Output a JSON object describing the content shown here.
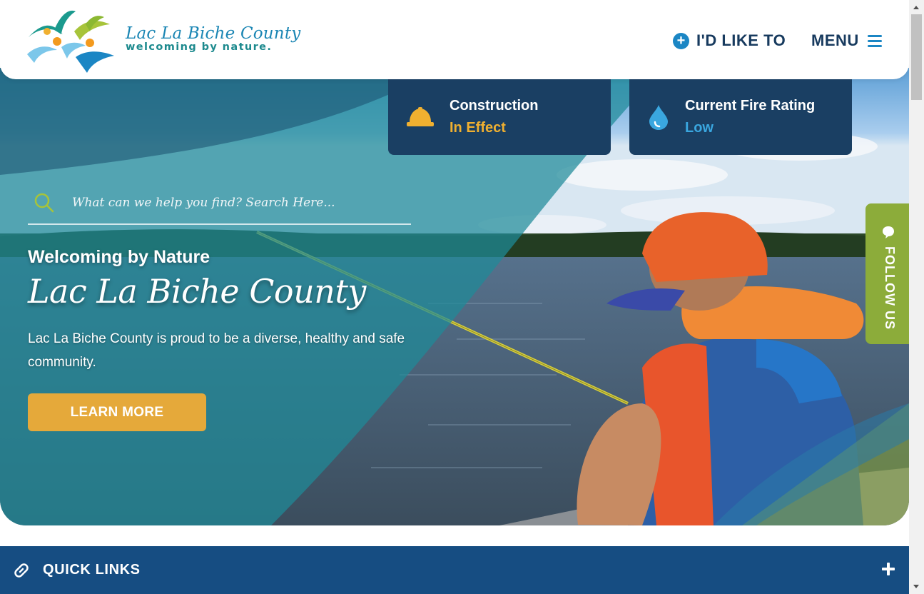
{
  "header": {
    "logo": {
      "title": "Lac La Biche County",
      "tagline": "welcoming by nature."
    },
    "nav": {
      "like_to_label": "I'D LIKE TO",
      "menu_label": "MENU"
    }
  },
  "status_cards": [
    {
      "title": "Construction",
      "value": "In Effect",
      "icon": "hard-hat-icon",
      "value_color": "#f0b030"
    },
    {
      "title": "Current Fire Rating",
      "value": "Low",
      "icon": "water-drop-icon",
      "value_color": "#3aa7e0"
    }
  ],
  "search": {
    "placeholder": "What can we help you find? Search Here..."
  },
  "hero": {
    "subtitle": "Welcoming by Nature",
    "title": "Lac La Biche County",
    "text": "Lac La Biche County is proud to be a diverse, healthy and safe community.",
    "button_label": "LEARN MORE"
  },
  "follow": {
    "label": "FOLLOW US"
  },
  "quick_links": {
    "label": "QUICK LINKS"
  },
  "colors": {
    "navy": "#173a5e",
    "accent_blue": "#1b86c4",
    "gold": "#e5a93a",
    "lime": "#8cac3a",
    "quick_links_bg": "#164d82"
  }
}
